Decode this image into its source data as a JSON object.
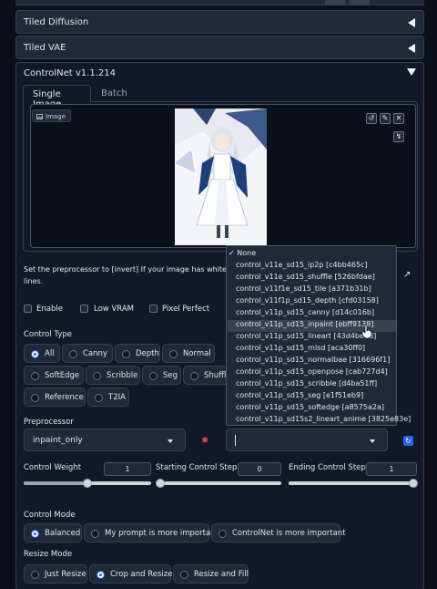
{
  "sections": {
    "tiled_diffusion": "Tiled Diffusion",
    "tiled_vae": "Tiled VAE",
    "controlnet": "ControlNet v1.1.214"
  },
  "tabs": {
    "single_image": "Single Image",
    "batch": "Batch"
  },
  "image": {
    "label": "Image"
  },
  "info_text": "Set the preprocessor to [invert] If your image has white backg",
  "info_text_tail": "lines.",
  "checkboxes": {
    "enable": "Enable",
    "low_vram": "Low VRAM",
    "pixel_perfect": "Pixel Perfect"
  },
  "control_type": {
    "label": "Control Type",
    "options": [
      "All",
      "Canny",
      "Depth",
      "Normal",
      "SoftEdge",
      "Scribble",
      "Seg",
      "Shuffle",
      "Reference",
      "T2IA"
    ],
    "selected": "All"
  },
  "preprocessor": {
    "label": "Preprocessor",
    "value": "inpaint_only"
  },
  "model": {
    "options": [
      "None",
      "control_v11e_sd15_ip2p [c4bb465c]",
      "control_v11e_sd15_shuffle [526bfdae]",
      "control_v11f1e_sd15_tile [a371b31b]",
      "control_v11f1p_sd15_depth [cfd03158]",
      "control_v11p_sd15_canny [d14c016b]",
      "control_v11p_sd15_inpaint [ebff9138]",
      "control_v11p_sd15_lineart [43d4be0d]",
      "control_v11p_sd15_mlsd [aca30ff0]",
      "control_v11p_sd15_normalbae [316696f1]",
      "control_v11p_sd15_openpose [cab727d4]",
      "control_v11p_sd15_scribble [d4ba51ff]",
      "control_v11p_sd15_seg [e1f51eb9]",
      "control_v11p_sd15_softedge [a8575a2a]",
      "control_v11p_sd15s2_lineart_anime [3825e83e]"
    ],
    "checked": "None",
    "hovered": "control_v11p_sd15_inpaint [ebff9138]"
  },
  "sliders": {
    "control_weight": {
      "label": "Control Weight",
      "value": "1",
      "fraction": 0.5
    },
    "starting_step": {
      "label": "Starting Control Step",
      "value": "0",
      "fraction": 0.0
    },
    "ending_step": {
      "label": "Ending Control Step",
      "value": "1",
      "fraction": 1.0
    }
  },
  "control_mode": {
    "label": "Control Mode",
    "options": [
      "Balanced",
      "My prompt is more important",
      "ControlNet is more important"
    ],
    "selected": "Balanced"
  },
  "resize_mode": {
    "label": "Resize Mode",
    "options": [
      "Just Resize",
      "Crop and Resize",
      "Resize and Fill"
    ],
    "selected": "Crop and Resize"
  },
  "colors": {
    "accent": "#2563eb",
    "background": "#0b0f19",
    "panel": "#1f2937"
  },
  "icons": [
    "image-icon",
    "undo-icon",
    "edit-icon",
    "close-icon",
    "transfer-icon",
    "explosion-icon",
    "refresh-icon",
    "check-icon"
  ]
}
